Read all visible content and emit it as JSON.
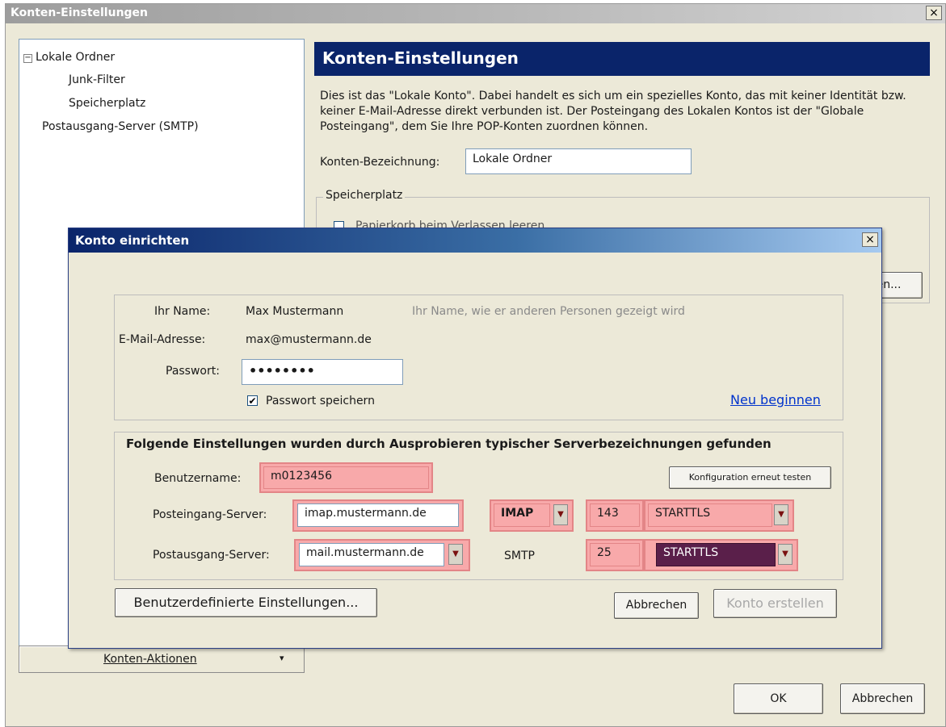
{
  "window": {
    "title": "Konten-Einstellungen",
    "close_glyph": "×"
  },
  "tree": {
    "items": [
      {
        "label": "Lokale Ordner",
        "expander": "−"
      },
      {
        "label": "Junk-Filter"
      },
      {
        "label": "Speicherplatz"
      },
      {
        "label": "Postausgang-Server (SMTP)"
      }
    ]
  },
  "konten_aktionen": {
    "label": "Konten-Aktionen",
    "arrow": "▾"
  },
  "settings": {
    "header": "Konten-Einstellungen",
    "description": "Dies ist das \"Lokale Konto\". Dabei handelt es sich um ein spezielles Konto, das mit keiner Identität bzw. keiner E-Mail-Adresse direkt verbunden ist. Der Posteingang des Lokalen Kontos ist der \"Globale Posteingang\", dem Sie Ihre POP-Konten zuordnen können.",
    "account_name_label": "Konten-Bezeichnung:",
    "account_name_value": "Lokale Ordner",
    "storage_legend": "Speicherplatz",
    "storage_checkbox_label": "Papierkorb beim Verlassen leeren",
    "partial_button_label": "en..."
  },
  "dialog": {
    "title": "Konto einrichten",
    "close_glyph": "×",
    "name_label": "Ihr Name:",
    "name_value": "Max Mustermann",
    "name_hint": "Ihr Name, wie er anderen Personen gezeigt wird",
    "email_label": "E-Mail-Adresse:",
    "email_value": "max@mustermann.de",
    "password_label": "Passwort:",
    "password_value": "••••••••",
    "save_password_label": "Passwort speichern",
    "save_password_checked": "✔",
    "restart_link": "Neu beginnen",
    "found_heading": "Folgende Einstellungen wurden durch Ausprobieren typischer Serverbezeichnungen gefunden",
    "username_label": "Benutzername:",
    "username_value": "m0123456",
    "retest_button": "Konfiguration erneut testen",
    "incoming_label": "Posteingang-Server:",
    "incoming_server": "imap.mustermann.de",
    "incoming_protocol": "IMAP",
    "incoming_port": "143",
    "incoming_security": "STARTTLS",
    "outgoing_label": "Postausgang-Server:",
    "outgoing_server": "mail.mustermann.de",
    "outgoing_protocol": "SMTP",
    "outgoing_port": "25",
    "outgoing_security": "STARTTLS",
    "dropdown_arrow": "▼",
    "custom_button": "Benutzerdefinierte Einstellungen...",
    "cancel_button": "Abbrechen",
    "create_button": "Konto erstellen"
  },
  "footer": {
    "ok_button": "OK",
    "cancel_button": "Abbrechen"
  },
  "colors": {
    "header_bg": "#0a246a",
    "highlight_pink": "#f8a9aa",
    "selected_dropdown": "#5a1f4a",
    "link": "#0033cc"
  }
}
